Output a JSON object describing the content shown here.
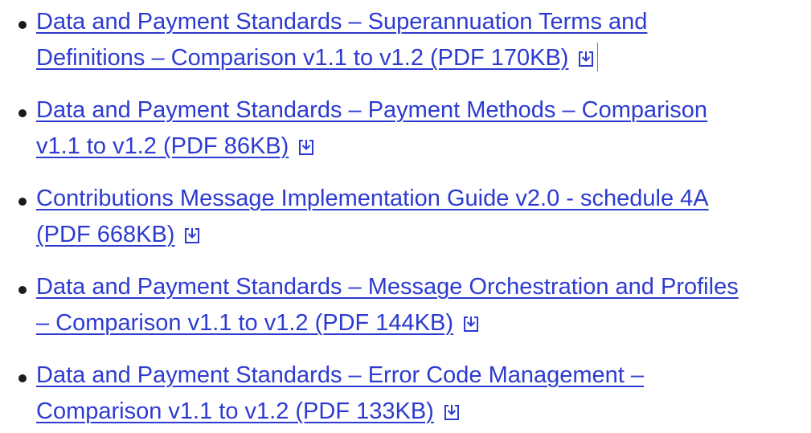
{
  "documents": [
    {
      "line1": "Data and Payment Standards – Superannuation Terms and",
      "line2": "Definitions – Comparison v1.1 to v1.2 (PDF 170KB)",
      "icon": "download-icon"
    },
    {
      "line1": "Data and Payment Standards – Payment Methods – Comparison",
      "line2": "v1.1 to v1.2 (PDF 86KB)",
      "icon": "download-icon"
    },
    {
      "line1": "Contributions Message Implementation Guide v2.0 - schedule 4A",
      "line2": "(PDF 668KB)",
      "icon": "download-icon"
    },
    {
      "line1": "Data and Payment Standards – Message Orchestration and Profiles",
      "line2": "– Comparison v1.1 to v1.2 (PDF 144KB)",
      "icon": "download-icon"
    },
    {
      "line1": "Data and Payment Standards – Error Code Management –",
      "line2": "Comparison v1.1 to v1.2 (PDF 133KB)",
      "icon": "download-icon"
    }
  ],
  "colors": {
    "link": "#2d3bd0",
    "bullet": "#1b1b1b",
    "background": "#ffffff"
  }
}
